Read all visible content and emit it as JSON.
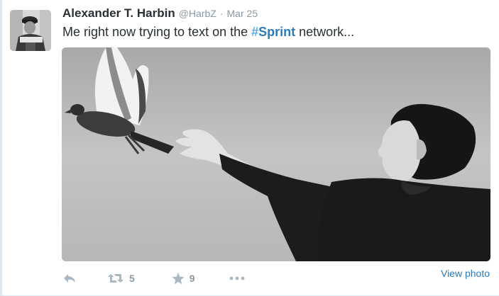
{
  "tweet": {
    "fullname": "Alexander T. Harbin",
    "username": "@HarbZ",
    "separator": "·",
    "timestamp": "Mar 25",
    "text_before": "Me right now trying to text on the ",
    "hashtag_symbol": "#",
    "hashtag_word": "Sprint",
    "text_after": " network..."
  },
  "actions": {
    "reply_icon": "reply-arrow-icon",
    "retweet_icon": "retweet-icon",
    "retweet_count": "5",
    "favorite_icon": "star-icon",
    "favorite_count": "9",
    "more_icon": "ellipsis-icon",
    "view_photo_label": "View photo"
  },
  "colors": {
    "link": "#2b7bb9",
    "muted": "#8899a6",
    "icon": "#aab8c2",
    "text": "#292f33"
  }
}
